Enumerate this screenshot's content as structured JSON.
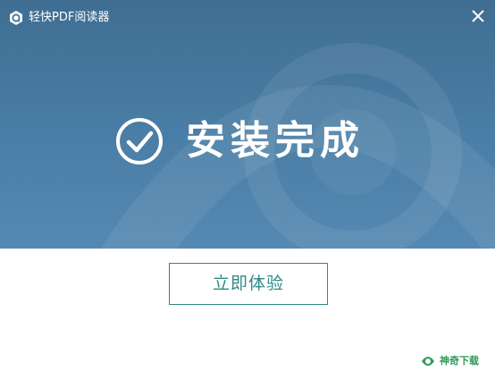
{
  "window": {
    "title": "轻快PDF阅读器"
  },
  "main": {
    "status_text": "安装完成",
    "start_button_label": "立即体验"
  },
  "watermark": {
    "brand_text": "神奇下载"
  },
  "colors": {
    "banner_top": "#3f6e92",
    "banner_bottom": "#5589b2",
    "accent": "#2e8a86",
    "brand_green": "#2f9a5a"
  },
  "icons": {
    "app": "app-logo-icon",
    "close": "close-icon",
    "status": "check-circle-icon",
    "brand": "brand-logo-icon"
  }
}
